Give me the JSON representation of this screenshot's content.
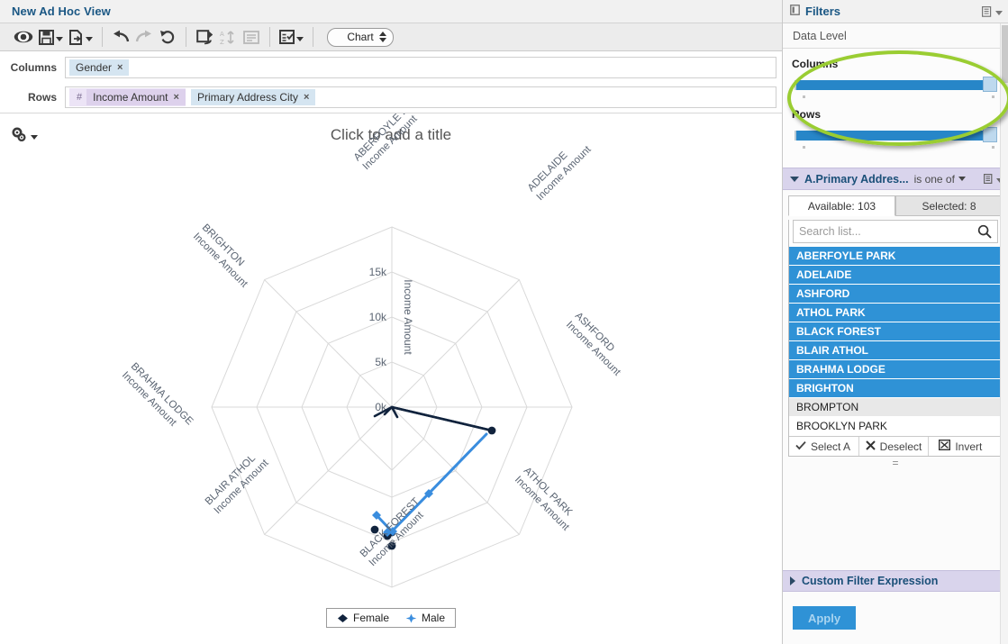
{
  "window": {
    "title": "New Ad Hoc View"
  },
  "toolbar": {
    "buttons": [
      {
        "name": "eye-icon",
        "label": "Display"
      },
      {
        "name": "save-icon",
        "label": "Save"
      },
      {
        "name": "export-icon",
        "label": "Export"
      },
      {
        "name": "undo-icon",
        "label": "Undo"
      },
      {
        "name": "redo-icon",
        "label": "Redo"
      },
      {
        "name": "revert-icon",
        "label": "Revert"
      },
      {
        "name": "switch-group-icon",
        "label": "Switch Groups"
      },
      {
        "name": "sort-icon",
        "label": "Sort"
      },
      {
        "name": "page-options-icon",
        "label": "Page Options"
      },
      {
        "name": "select-fields-icon",
        "label": "Select Fields"
      }
    ],
    "view_select": {
      "value": "Chart"
    }
  },
  "shelves": {
    "columns_label": "Columns",
    "columns_fields": [
      {
        "label": "Gender",
        "remove": "×"
      }
    ],
    "rows_label": "Rows",
    "rows_measure_symbol": "#",
    "rows_fields": [
      {
        "label": "Income Amount",
        "remove": "×"
      },
      {
        "label": "Primary Address City",
        "remove": "×"
      }
    ]
  },
  "canvas": {
    "title_placeholder": "Click to add a title",
    "options_icon": "gear-icon"
  },
  "chart_data": {
    "type": "radar",
    "title": "",
    "value_axis_title": "Income Amount",
    "tick_labels": [
      "0k",
      "5k",
      "10k",
      "15k"
    ],
    "tick_values": [
      0,
      5000,
      10000,
      15000
    ],
    "ylim": [
      0,
      17500
    ],
    "grid": true,
    "legend_position": "bottom",
    "categories": [
      "ABERFOYLE PARK\nIncome Amount",
      "ADELAIDE\nIncome Amount",
      "ASHFORD\nIncome Amount",
      "ATHOL PARK\nIncome Amount",
      "BLACK FOREST\nIncome Amount",
      "BLAIR ATHOL\nIncome Amount",
      "BRAHMA LODGE\nIncome Amount",
      "BRIGHTON\nIncome Amount"
    ],
    "series": [
      {
        "name": "Female",
        "color": "#11233d",
        "values": [
          0,
          11800,
          0,
          1000,
          0,
          0,
          1200,
          0
        ]
      },
      {
        "name": "Male",
        "color": "#3a8dde",
        "values": [
          900,
          11500,
          0,
          0,
          0,
          0,
          1800,
          0
        ]
      }
    ],
    "legend": [
      {
        "label": "Female",
        "color": "#11233d"
      },
      {
        "label": "Male",
        "color": "#3a8dde"
      }
    ]
  },
  "sidebar": {
    "title": "Filters",
    "header_menu_icon": "list-menu-icon",
    "data_level_label": "Data Level",
    "sliders": [
      {
        "name": "columns",
        "label": "Columns",
        "fill_percent": 100
      },
      {
        "name": "rows",
        "label": "Rows",
        "fill_percent": 100
      }
    ],
    "filter": {
      "name": "A.Primary Addres...",
      "operator": "is one of",
      "menu_icon": "list-menu-icon",
      "tabs": [
        {
          "label": "Available: 103",
          "active": true
        },
        {
          "label": "Selected: 8",
          "active": false
        }
      ],
      "search_placeholder": "Search list...",
      "search_value": "",
      "search_icon": "search-icon",
      "options": [
        {
          "label": "ABERFOYLE PARK",
          "state": "selected"
        },
        {
          "label": "ADELAIDE",
          "state": "selected"
        },
        {
          "label": "ASHFORD",
          "state": "selected"
        },
        {
          "label": "ATHOL PARK",
          "state": "selected"
        },
        {
          "label": "BLACK FOREST",
          "state": "selected"
        },
        {
          "label": "BLAIR ATHOL",
          "state": "selected"
        },
        {
          "label": "BRAHMA LODGE",
          "state": "selected"
        },
        {
          "label": "BRIGHTON",
          "state": "selected"
        },
        {
          "label": "BROMPTON",
          "state": "hover"
        },
        {
          "label": "BROOKLYN PARK",
          "state": "normal"
        }
      ],
      "actions": [
        {
          "label": "Select A",
          "icon": "check-icon"
        },
        {
          "label": "Deselect",
          "icon": "x-icon"
        },
        {
          "label": "Invert",
          "icon": "invert-icon"
        }
      ],
      "resize_handle": "="
    },
    "custom_filter_expression": {
      "label": "Custom Filter Expression"
    },
    "apply_button": {
      "label": "Apply"
    }
  },
  "annotation": {
    "shape": "ellipse",
    "color": "#9acd32"
  }
}
